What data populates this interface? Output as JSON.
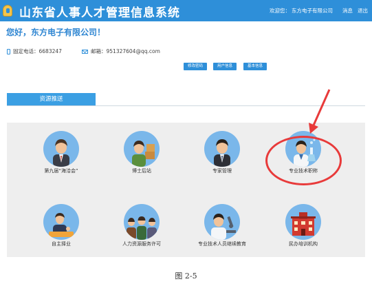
{
  "header": {
    "title": "山东省人事人才管理信息系统",
    "welcome_prefix": "欢迎您：",
    "welcome_company": "东方电子有限公司",
    "link_messages": "消息",
    "link_logout": "退出"
  },
  "colors": {
    "header_blue": "#2e8fd9",
    "accent_blue": "#3b9fe3",
    "annotation_red": "#e83a3a"
  },
  "profile": {
    "greeting": "您好，东方电子有限公司！",
    "phone_label": "固定电话：",
    "phone_value": "6683247",
    "email_label": "邮箱：",
    "email_value": "951327604@qq.com"
  },
  "actions": [
    {
      "label": "修改密码"
    },
    {
      "label": "用户信息"
    },
    {
      "label": "基本信息"
    }
  ],
  "tab": {
    "label": "资源推送"
  },
  "tiles": [
    {
      "label": "第九届“海洽会”",
      "icon": "businessman-icon"
    },
    {
      "label": "博士后站",
      "icon": "worker-boxes-icon"
    },
    {
      "label": "专家管理",
      "icon": "expert-icon"
    },
    {
      "label": "专业技术职称",
      "icon": "scientist-icon"
    },
    {
      "label": "自主择业",
      "icon": "handshake-icon"
    },
    {
      "label": "人力资源服务许可",
      "icon": "team-icon"
    },
    {
      "label": "专业技术人员继续教育",
      "icon": "microscope-icon"
    },
    {
      "label": "民办培训机构",
      "icon": "building-icon"
    }
  ],
  "caption": "图 2-5"
}
